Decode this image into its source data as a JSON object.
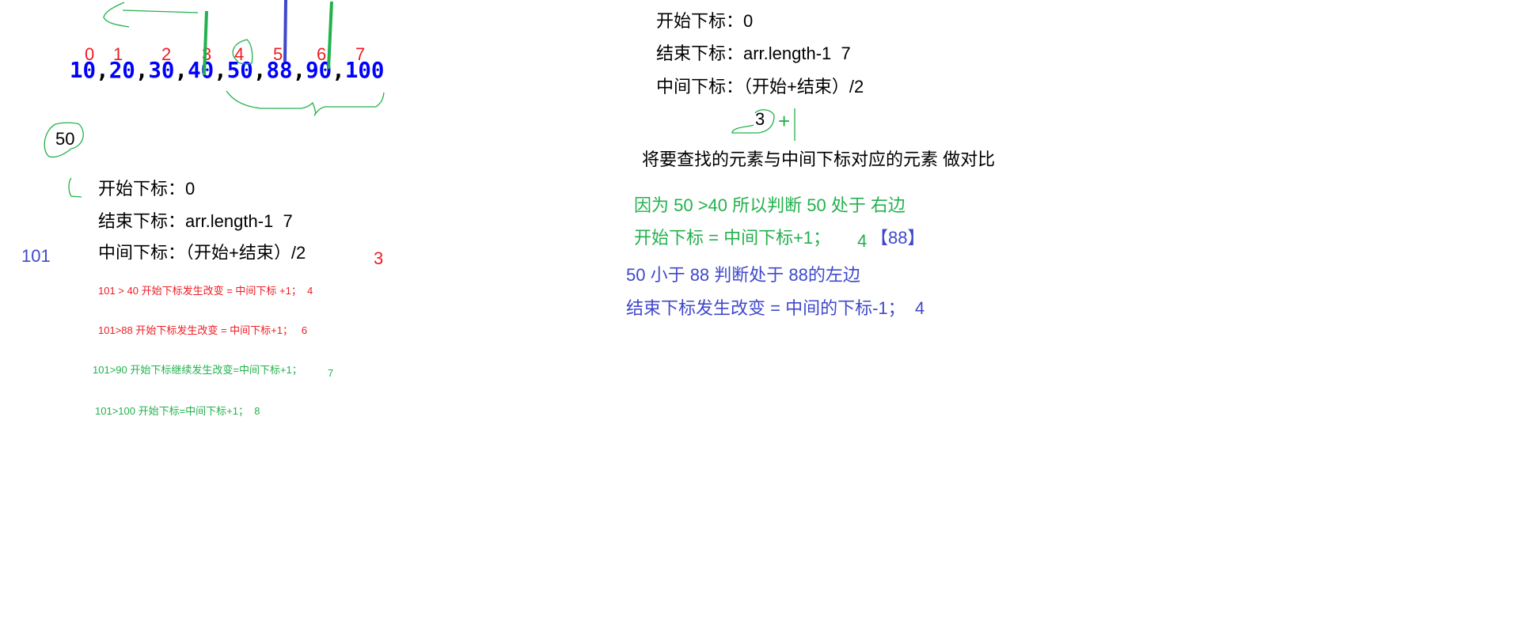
{
  "array": {
    "values": [
      "10",
      "20",
      "30",
      "40",
      "50",
      "88",
      "90",
      "100"
    ],
    "separator": ",",
    "indices": [
      "0",
      "1",
      "2",
      "3",
      "4",
      "5",
      "6",
      "7"
    ]
  },
  "left": {
    "target": "50",
    "start": "开始下标：0",
    "end": "结束下标：arr.length-1  7",
    "mid": "中间下标：（开始+结束）/2",
    "search_value": "101",
    "mid_result": "3",
    "steps": [
      {
        "text": "101 > 40 开始下标发生改变 = 中间下标 +1；  4"
      },
      {
        "text": "101>88 开始下标发生改变 = 中间下标+1；   6"
      },
      {
        "text": "101>90 开始下标继续发生改变=中间下标+1；",
        "result": "7"
      },
      {
        "text": "101>100 开始下标=中间下标+1；  8"
      }
    ]
  },
  "right": {
    "start": "开始下标：0",
    "end": "结束下标：arr.length-1  7",
    "mid": "中间下标：（开始+结束）/2",
    "mid_result": "3",
    "plus": "+",
    "compare": "将要查找的元素与中间下标对应的元素 做对比",
    "green_line1": "因为 50 >40 所以判断 50 处于 右边",
    "green_line2": "开始下标 = 中间下标+1；",
    "new_start": "4",
    "new_value": "【88】",
    "blue_line1": "50 小于 88 判断处于 88的左边",
    "blue_line2": "结束下标发生改变 = 中间的下标-1；  4"
  },
  "colors": {
    "red": "#ed1c24",
    "green": "#22b14c",
    "blue": "#3f48cc",
    "array_blue": "#0000ff"
  }
}
